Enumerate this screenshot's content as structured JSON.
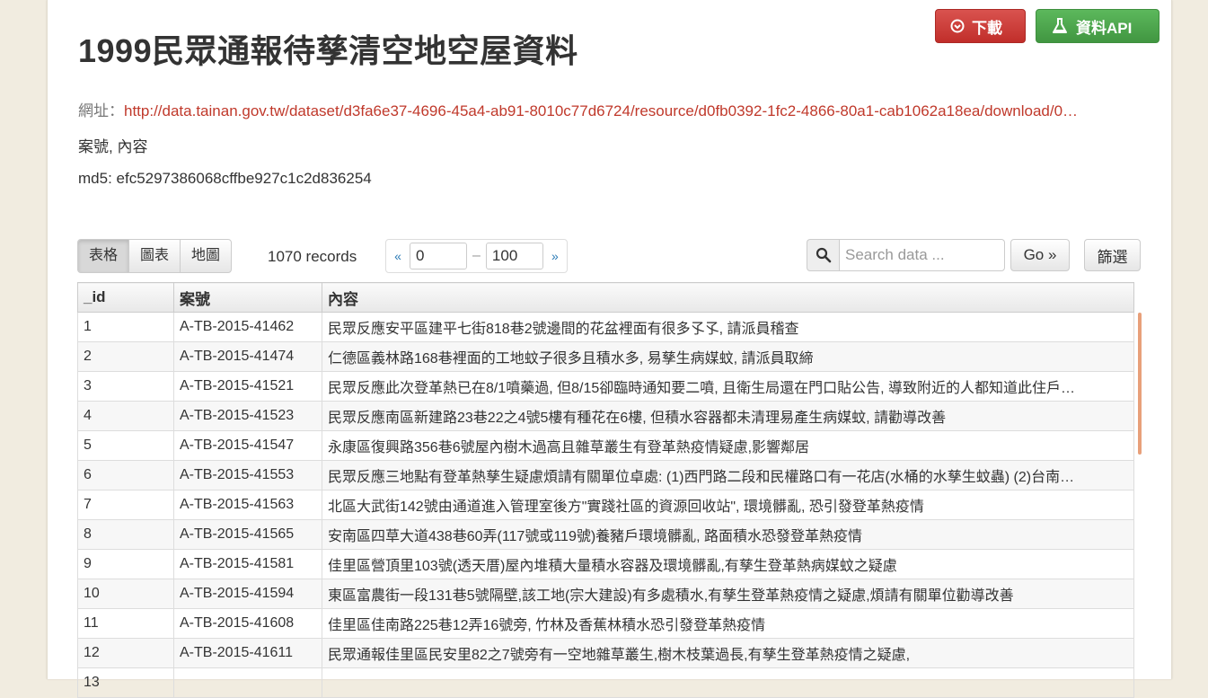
{
  "header": {
    "title": "1999民眾通報待孳清空地空屋資料",
    "download_label": "下載",
    "api_label": "資料API",
    "download_color": "#d9534f",
    "api_color": "#5cb85c"
  },
  "meta": {
    "url_label": "網址：",
    "url": "http://data.tainan.gov.tw/dataset/d3fa6e37-4696-45a4-ab91-8010c77d6724/resource/d0fb0392-1fc2-4866-80a1-cab1062a18ea/download/0…",
    "fields": "案號, 內容",
    "md5": "md5: efc5297386068cffbe927c1c2d836254"
  },
  "toolbar": {
    "views": [
      "表格",
      "圖表",
      "地圖"
    ],
    "records": "1070 records",
    "prev": "«",
    "next": "»",
    "from": "0",
    "dash": "–",
    "to": "100",
    "search_placeholder": "Search data ...",
    "go_label": "Go »",
    "filter_label": "篩選"
  },
  "table": {
    "columns": [
      "_id",
      "案號",
      "內容"
    ],
    "rows": [
      [
        "1",
        "A-TB-2015-41462",
        "民眾反應安平區建平七街818巷2號邊間的花盆裡面有很多孓孓, 請派員稽查"
      ],
      [
        "2",
        "A-TB-2015-41474",
        "仁德區義林路168巷裡面的工地蚊子很多且積水多, 易孳生病媒蚊, 請派員取締"
      ],
      [
        "3",
        "A-TB-2015-41521",
        "民眾反應此次登革熱已在8/1噴藥過, 但8/15卻臨時通知要二噴, 且衛生局還在門口貼公告, 導致附近的人都知道此住戶…"
      ],
      [
        "4",
        "A-TB-2015-41523",
        "民眾反應南區新建路23巷22之4號5樓有種花在6樓, 但積水容器都未清理易產生病媒蚊, 請勸導改善"
      ],
      [
        "5",
        "A-TB-2015-41547",
        "永康區復興路356巷6號屋內樹木過高且雜草叢生有登革熱疫情疑慮,影響鄰居"
      ],
      [
        "6",
        "A-TB-2015-41553",
        "民眾反應三地點有登革熱孳生疑慮煩請有關單位卓處: (1)西門路二段和民權路口有一花店(水桶的水孳生蚊蟲) (2)台南…"
      ],
      [
        "7",
        "A-TB-2015-41563",
        "北區大武街142號由通道進入管理室後方\"實踐社區的資源回收站\", 環境髒亂, 恐引發登革熱疫情"
      ],
      [
        "8",
        "A-TB-2015-41565",
        "安南區四草大道438巷60弄(117號或119號)養豬戶環境髒亂, 路面積水恐發登革熱疫情"
      ],
      [
        "9",
        "A-TB-2015-41581",
        "佳里區營頂里103號(透天厝)屋內堆積大量積水容器及環境髒亂,有孳生登革熱病媒蚊之疑慮"
      ],
      [
        "10",
        "A-TB-2015-41594",
        "東區富農街一段131巷5號隔壁,該工地(宗大建設)有多處積水,有孳生登革熱疫情之疑慮,煩請有關單位勸導改善"
      ],
      [
        "11",
        "A-TB-2015-41608",
        "佳里區佳南路225巷12弄16號旁, 竹林及香蕉林積水恐引發登革熱疫情"
      ],
      [
        "12",
        "A-TB-2015-41611",
        "民眾通報佳里區民安里82之7號旁有一空地雜草叢生,樹木枝葉過長,有孳生登革熱疫情之疑慮,"
      ],
      [
        "13",
        "",
        ""
      ]
    ]
  }
}
